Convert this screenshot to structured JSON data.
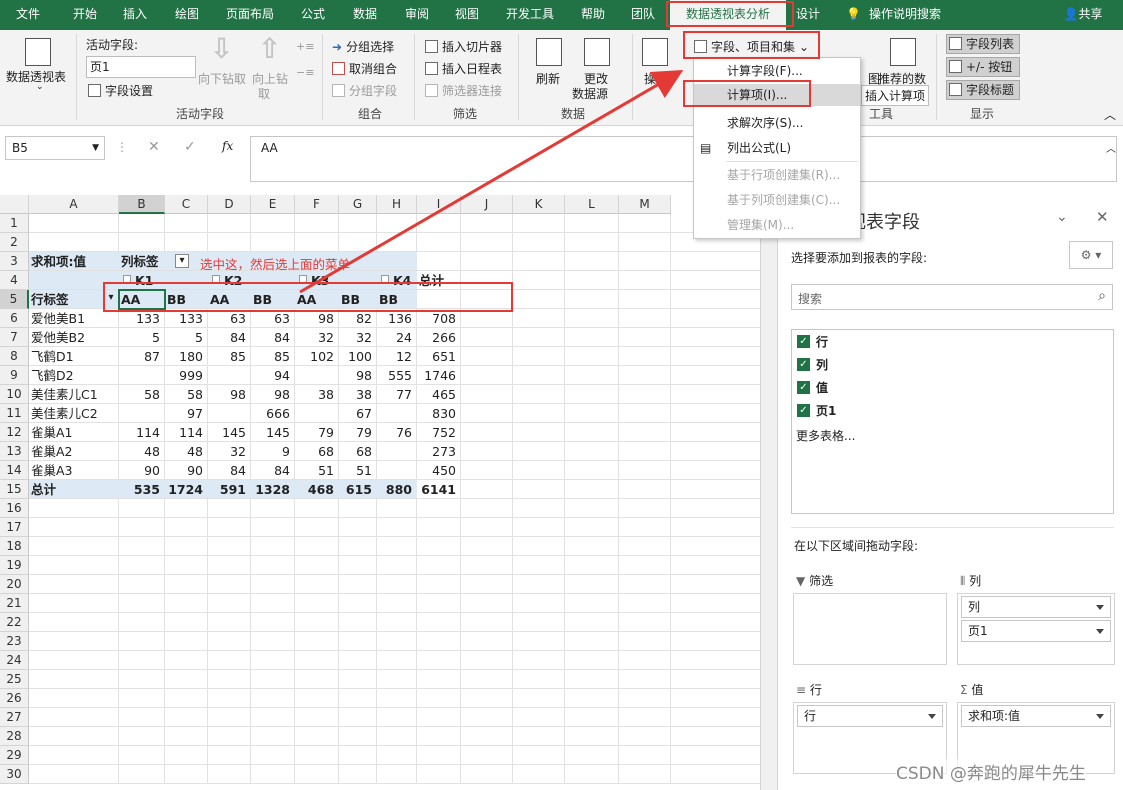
{
  "tabs": [
    "文件",
    "开始",
    "插入",
    "绘图",
    "页面布局",
    "公式",
    "数据",
    "审阅",
    "视图",
    "开发工具",
    "帮助",
    "团队",
    "数据透视表分析",
    "设计"
  ],
  "tell_me": "操作说明搜索",
  "share": "共享",
  "ribbon": {
    "pivot_table": "数据透视表",
    "active_field_label": "活动字段:",
    "active_field_value": "页1",
    "field_settings": "字段设置",
    "drill_down": "向下钻取",
    "drill_up_1": "向上钻",
    "drill_up_2": "取",
    "group_active_field": "活动字段",
    "group_selection": "分组选择",
    "ungroup": "取消组合",
    "group_field": "分组字段",
    "group_group": "组合",
    "insert_slicer": "插入切片器",
    "insert_timeline": "插入日程表",
    "filter_connections": "筛选器连接",
    "group_filter": "筛选",
    "refresh": "刷新",
    "change_source_1": "更改",
    "change_source_2": "数据源",
    "group_data": "数据",
    "actions": "操作",
    "fields_items_sets": "字段、项目和集",
    "pivot_chart": "图",
    "recommended": "推荐的数",
    "group_tools": "工具",
    "field_list": "字段列表",
    "plus_minus": "+/- 按钮",
    "field_headers": "字段标题",
    "group_show": "显示"
  },
  "tooltip": "插入计算项",
  "menu": {
    "items": [
      "计算字段(F)...",
      "计算项(I)...",
      "求解次序(S)...",
      "列出公式(L)",
      "基于行项创建集(R)...",
      "基于列项创建集(C)...",
      "管理集(M)..."
    ]
  },
  "formula_bar": {
    "name_box": "B5",
    "fx": "fx",
    "content": "AA"
  },
  "sheet": {
    "columns": [
      "A",
      "B",
      "C",
      "D",
      "E",
      "F",
      "G",
      "H",
      "I",
      "J",
      "K",
      "L",
      "M"
    ],
    "rows": [
      "1",
      "2",
      "3",
      "4",
      "5",
      "6",
      "7",
      "8",
      "9",
      "10",
      "11",
      "12",
      "13",
      "14",
      "15",
      "16",
      "17",
      "18",
      "19",
      "20",
      "21",
      "22",
      "23",
      "24",
      "25",
      "26",
      "27",
      "28",
      "29",
      "30"
    ],
    "sum_label": "求和项:值",
    "col_label": "列标签",
    "k_headers": [
      "K1",
      "K2",
      "K3",
      "K4"
    ],
    "grand_total": "总计",
    "row_label": "行标签",
    "sub_headers": [
      "AA",
      "BB",
      "AA",
      "BB",
      "AA",
      "BB",
      "BB"
    ],
    "data": [
      {
        "name": "爱他美B1",
        "v": [
          "133",
          "133",
          "63",
          "63",
          "98",
          "82",
          "136",
          "708"
        ]
      },
      {
        "name": "爱他美B2",
        "v": [
          "5",
          "5",
          "84",
          "84",
          "32",
          "32",
          "24",
          "266"
        ]
      },
      {
        "name": "飞鹤D1",
        "v": [
          "87",
          "180",
          "85",
          "85",
          "102",
          "100",
          "12",
          "651"
        ]
      },
      {
        "name": "飞鹤D2",
        "v": [
          "",
          "999",
          "",
          "94",
          "",
          "98",
          "555",
          "1746"
        ]
      },
      {
        "name": "美佳素儿C1",
        "v": [
          "58",
          "58",
          "98",
          "98",
          "38",
          "38",
          "77",
          "465"
        ]
      },
      {
        "name": "美佳素儿C2",
        "v": [
          "",
          "97",
          "",
          "666",
          "",
          "67",
          "",
          "830"
        ]
      },
      {
        "name": "雀巢A1",
        "v": [
          "114",
          "114",
          "145",
          "145",
          "79",
          "79",
          "76",
          "752"
        ]
      },
      {
        "name": "雀巢A2",
        "v": [
          "48",
          "48",
          "32",
          "9",
          "68",
          "68",
          "",
          "273"
        ]
      },
      {
        "name": "雀巢A3",
        "v": [
          "90",
          "90",
          "84",
          "84",
          "51",
          "51",
          "",
          "450"
        ]
      }
    ],
    "total_row": {
      "name": "总计",
      "v": [
        "535",
        "1724",
        "591",
        "1328",
        "468",
        "615",
        "880",
        "6141"
      ]
    },
    "annotation": "选中这，然后选上面的菜单"
  },
  "panel": {
    "title": "视表字段",
    "subtitle": "选择要添加到报表的字段:",
    "search_placeholder": "搜索",
    "fields": [
      "行",
      "列",
      "值",
      "页1"
    ],
    "more_tables": "更多表格...",
    "drag_hint": "在以下区域间拖动字段:",
    "filter_label": "筛选",
    "columns_label": "列",
    "rows_label": "行",
    "values_label": "值",
    "col_items": [
      "列",
      "页1"
    ],
    "row_items": [
      "行"
    ],
    "val_items": [
      "求和项:值"
    ]
  },
  "watermark": "CSDN @奔跑的犀牛先生",
  "colors": {
    "excel_green": "#217346",
    "annotation_red": "#e53935"
  }
}
